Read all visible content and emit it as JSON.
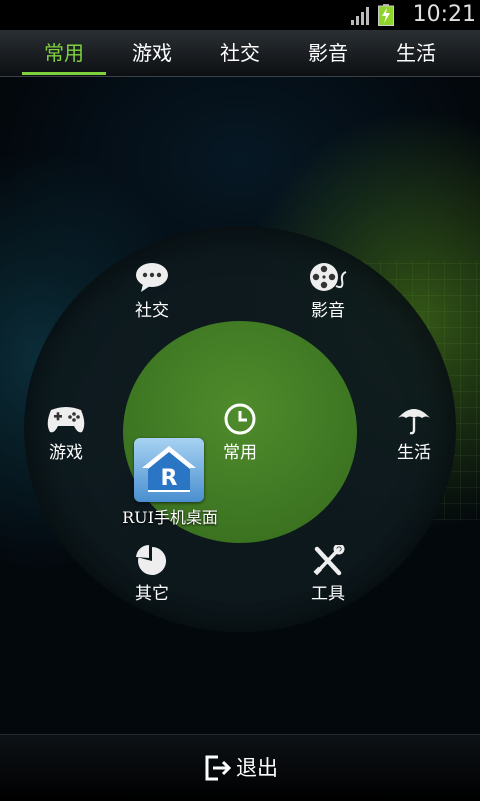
{
  "status_bar": {
    "time": "10:21"
  },
  "tabs": [
    {
      "label": "常用",
      "active": true
    },
    {
      "label": "游戏",
      "active": false
    },
    {
      "label": "社交",
      "active": false
    },
    {
      "label": "影音",
      "active": false
    },
    {
      "label": "生活",
      "active": false
    }
  ],
  "wheel": {
    "center": {
      "label": "常用",
      "icon": "clock-icon"
    },
    "items": [
      {
        "label": "社交",
        "icon": "chat-bubble-icon"
      },
      {
        "label": "影音",
        "icon": "film-reel-icon"
      },
      {
        "label": "游戏",
        "icon": "gamepad-icon"
      },
      {
        "label": "生活",
        "icon": "umbrella-icon"
      },
      {
        "label": "其它",
        "icon": "pie-chart-icon"
      },
      {
        "label": "工具",
        "icon": "wrench-screwdriver-icon"
      }
    ]
  },
  "shortcut": {
    "label": "RUI手机桌面",
    "icon": "rui-house-icon"
  },
  "bottom": {
    "exit_label": "退出",
    "icon": "exit-icon"
  },
  "colors": {
    "accent": "#7ed23e",
    "inner_disc": "#3f7a22",
    "battery": "#8fd42a"
  }
}
